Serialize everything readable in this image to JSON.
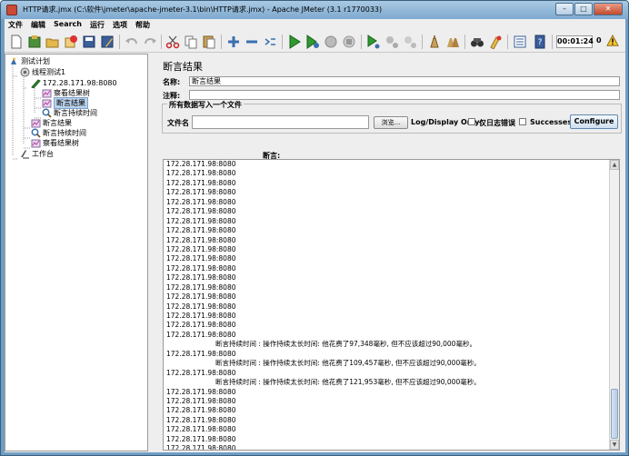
{
  "window": {
    "title": "HTTP请求.jmx (C:\\软件\\jmeter\\apache-jmeter-3.1\\bin\\HTTP请求.jmx) - Apache JMeter (3.1 r1770033)",
    "buttons": {
      "minimize": "–",
      "maximize": "□",
      "close": "✕"
    }
  },
  "menu": [
    "文件",
    "编辑",
    "Search",
    "运行",
    "选项",
    "帮助"
  ],
  "toolbar": {
    "icons": [
      "new-icon",
      "templates-icon",
      "open-icon",
      "close-icon",
      "save-icon",
      "save-as-icon",
      "undo-icon",
      "redo-icon",
      "cut-icon",
      "copy-icon",
      "paste-icon",
      "expand-icon",
      "collapse-icon",
      "toggle-icon",
      "start-icon",
      "start-no-pause-icon",
      "stop-icon",
      "shutdown-icon",
      "remote-start-icon",
      "remote-stop-icon",
      "remote-shutdown-icon",
      "clear-icon",
      "clear-all-icon",
      "search-icon",
      "reset-search-icon",
      "function-helper-icon",
      "help-icon"
    ],
    "timer": "00:01:24",
    "error_count": "0"
  },
  "tree": {
    "items": [
      {
        "label": "测试计划",
        "icon": "test-plan-icon"
      },
      {
        "label": "线程测试1",
        "icon": "thread-group-icon"
      },
      {
        "label": "172.28.171.98:8080",
        "icon": "sampler-icon"
      },
      {
        "label": "察看结果树",
        "icon": "listener-icon"
      },
      {
        "label": "断言结果",
        "icon": "listener-icon",
        "selected": true
      },
      {
        "label": "断言持续时间",
        "icon": "assertion-icon"
      },
      {
        "label": "断言结果",
        "icon": "listener-icon"
      },
      {
        "label": "断言持续时间",
        "icon": "assertion-icon"
      },
      {
        "label": "察看结果树",
        "icon": "listener-icon"
      },
      {
        "label": "工作台",
        "icon": "workbench-icon"
      }
    ]
  },
  "panel": {
    "title": "断言结果",
    "name_label": "名称:",
    "name_value": "断言结果",
    "comment_label": "注释:",
    "comment_value": "",
    "group_title": "所有数据写入一个文件",
    "filename_label": "文件名",
    "filename_value": "",
    "browse_label": "浏览...",
    "log_display_label": "Log/Display Only:",
    "errors_only_label": "仅日志错误",
    "successes_label": "Successes",
    "configure_label": "Configure",
    "results_label": "断言:"
  },
  "results": {
    "lines": [
      {
        "text": "172.28.171.98:8080"
      },
      {
        "text": "172.28.171.98:8080"
      },
      {
        "text": "172.28.171.98:8080"
      },
      {
        "text": "172.28.171.98:8080"
      },
      {
        "text": "172.28.171.98:8080"
      },
      {
        "text": "172.28.171.98:8080"
      },
      {
        "text": "172.28.171.98:8080"
      },
      {
        "text": "172.28.171.98:8080"
      },
      {
        "text": "172.28.171.98:8080"
      },
      {
        "text": "172.28.171.98:8080"
      },
      {
        "text": "172.28.171.98:8080"
      },
      {
        "text": "172.28.171.98:8080"
      },
      {
        "text": "172.28.171.98:8080"
      },
      {
        "text": "172.28.171.98:8080"
      },
      {
        "text": "172.28.171.98:8080"
      },
      {
        "text": "172.28.171.98:8080"
      },
      {
        "text": "172.28.171.98:8080"
      },
      {
        "text": "172.28.171.98:8080"
      },
      {
        "text": "172.28.171.98:8080"
      },
      {
        "text": "断言持续时间 : 操作持续太长时间: 他花费了97,348毫秒, 但不应该超过90,000毫秒。",
        "msg": true
      },
      {
        "text": "172.28.171.98:8080"
      },
      {
        "text": "断言持续时间 : 操作持续太长时间: 他花费了109,457毫秒, 但不应该超过90,000毫秒。",
        "msg": true
      },
      {
        "text": "172.28.171.98:8080"
      },
      {
        "text": "断言持续时间 : 操作持续太长时间: 他花费了121,953毫秒, 但不应该超过90,000毫秒。",
        "msg": true
      },
      {
        "text": "172.28.171.98:8080"
      },
      {
        "text": "172.28.171.98:8080"
      },
      {
        "text": "172.28.171.98:8080"
      },
      {
        "text": "172.28.171.98:8080"
      },
      {
        "text": "172.28.171.98:8080"
      },
      {
        "text": "172.28.171.98:8080"
      },
      {
        "text": "172.28.171.98:8080"
      }
    ]
  }
}
